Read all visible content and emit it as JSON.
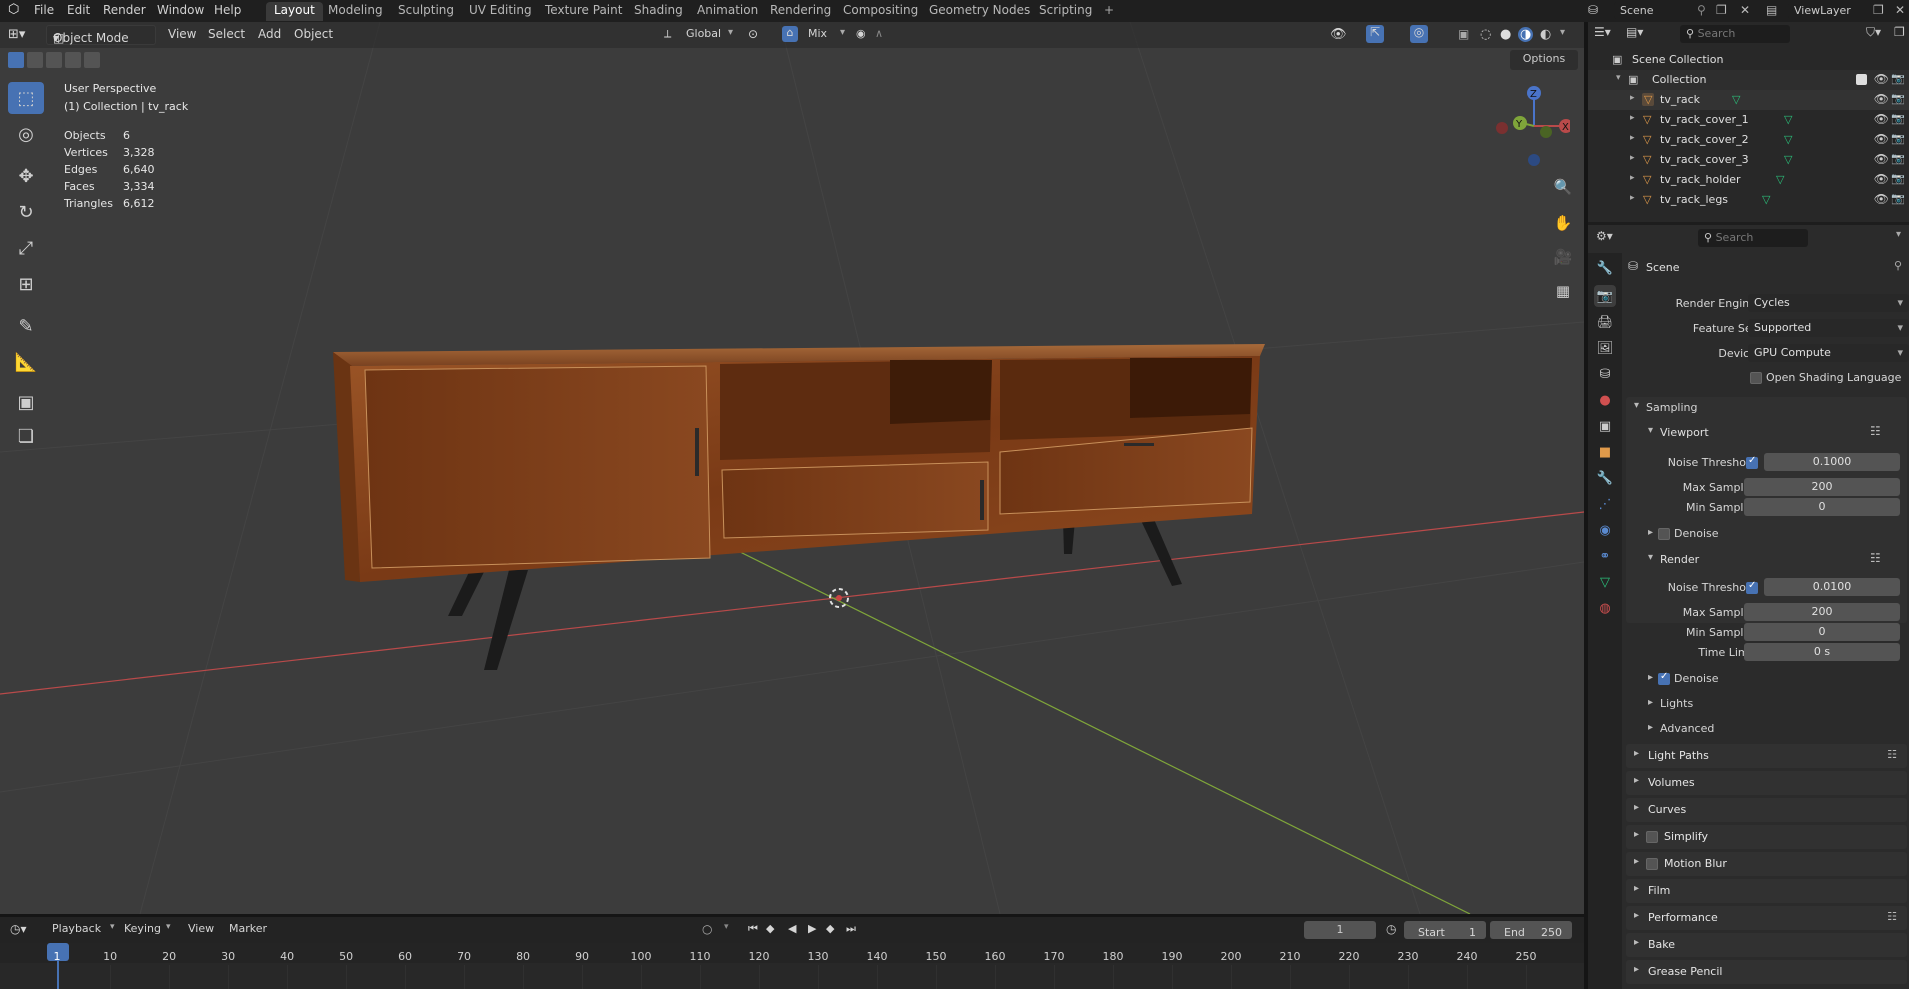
{
  "topbar": {
    "menus": [
      "File",
      "Edit",
      "Render",
      "Window",
      "Help"
    ],
    "workspaces": [
      "Layout",
      "Modeling",
      "Sculpting",
      "UV Editing",
      "Texture Paint",
      "Shading",
      "Animation",
      "Rendering",
      "Compositing",
      "Geometry Nodes",
      "Scripting"
    ],
    "active_workspace": "Layout",
    "add_tab": "+",
    "scene_name": "Scene",
    "view_layer": "ViewLayer"
  },
  "viewport": {
    "mode": "Object Mode",
    "menus": [
      "View",
      "Select",
      "Add",
      "Object"
    ],
    "orientation": "Global",
    "snap_label": "Mix",
    "options_label": "Options",
    "perspective": "User Perspective",
    "collection_info": "(1) Collection | tv_rack",
    "stats": [
      {
        "label": "Objects",
        "value": "6"
      },
      {
        "label": "Vertices",
        "value": "3,328"
      },
      {
        "label": "Edges",
        "value": "6,640"
      },
      {
        "label": "Faces",
        "value": "3,334"
      },
      {
        "label": "Triangles",
        "value": "6,612"
      }
    ],
    "gizmo": {
      "x": "X",
      "y": "Y",
      "z": "Z"
    }
  },
  "outliner": {
    "search_placeholder": "Search",
    "scene_collection": "Scene Collection",
    "collection": "Collection",
    "objects": [
      "tv_rack",
      "tv_rack_cover_1",
      "tv_rack_cover_2",
      "tv_rack_cover_3",
      "tv_rack_holder",
      "tv_rack_legs"
    ]
  },
  "properties": {
    "search_placeholder": "Search",
    "context": "Scene",
    "render_engine_label": "Render Engine",
    "render_engine": "Cycles",
    "feature_set_label": "Feature Set",
    "feature_set": "Supported",
    "device_label": "Device",
    "device": "GPU Compute",
    "osl_label": "Open Shading Language",
    "sampling": "Sampling",
    "viewport": "Viewport",
    "noise_threshold_label": "Noise Threshold",
    "viewport_noise_threshold": "0.1000",
    "max_samples_label": "Max Samples",
    "viewport_max_samples": "200",
    "min_samples_label": "Min Samples",
    "viewport_min_samples": "0",
    "denoise_label": "Denoise",
    "render": "Render",
    "render_noise_threshold": "0.0100",
    "render_max_samples": "200",
    "render_min_samples": "0",
    "time_limit_label": "Time Limit",
    "time_limit": "0 s",
    "lights": "Lights",
    "advanced": "Advanced",
    "panels": [
      "Light Paths",
      "Volumes",
      "Curves",
      "Simplify",
      "Motion Blur",
      "Film",
      "Performance",
      "Bake",
      "Grease Pencil"
    ]
  },
  "timeline": {
    "menus": [
      "Playback",
      "Keying",
      "View",
      "Marker"
    ],
    "current_frame": "1",
    "start_label": "Start",
    "start": "1",
    "end_label": "End",
    "end": "250",
    "ticks": [
      "1",
      "10",
      "20",
      "30",
      "40",
      "50",
      "60",
      "70",
      "80",
      "90",
      "100",
      "110",
      "120",
      "130",
      "140",
      "150",
      "160",
      "170",
      "180",
      "190",
      "200",
      "210",
      "220",
      "230",
      "240",
      "250"
    ]
  },
  "colors": {
    "accent": "#4772b3",
    "x_axis": "#b94a4a",
    "y_axis": "#7fa53a",
    "z_axis": "#4a74c9",
    "wood": "#8a4a1f",
    "mesh_icon": "#2bbf7a",
    "object_icon": "#e09a4a"
  }
}
